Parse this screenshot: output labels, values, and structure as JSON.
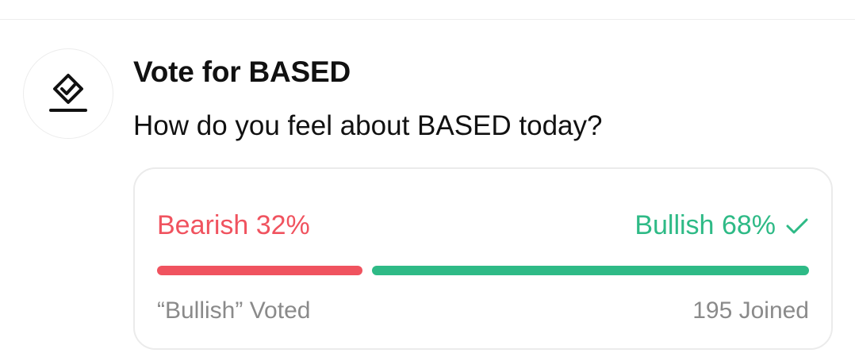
{
  "poll": {
    "title": "Vote for BASED",
    "question": "How do you feel about BASED today?",
    "icon": "vote-diamond-check-icon",
    "options": [
      {
        "label": "Bearish",
        "percent_text": "32%",
        "share": 0.32,
        "color": "#f0535f",
        "selected": false
      },
      {
        "label": "Bullish",
        "percent_text": "68%",
        "share": 0.68,
        "color": "#2eba86",
        "selected": true,
        "selected_icon": "checkmark-icon"
      }
    ],
    "voted_text": "“Bullish” Voted",
    "joined_text": "195 Joined"
  }
}
